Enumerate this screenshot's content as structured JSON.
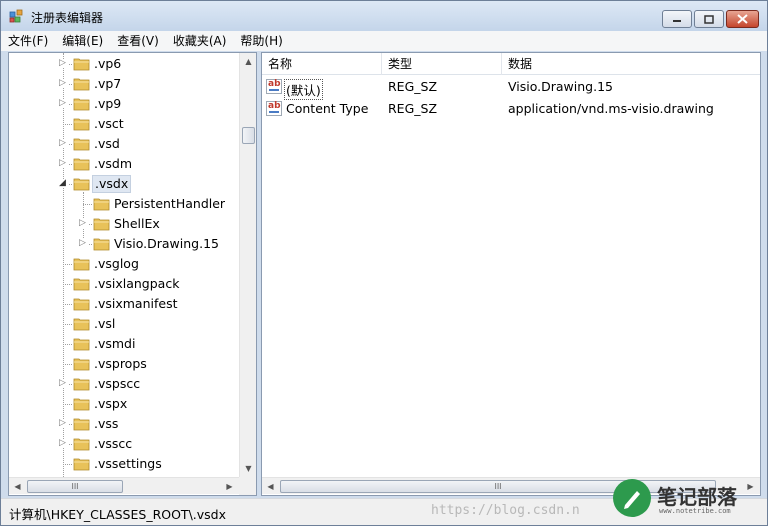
{
  "window": {
    "title": "注册表编辑器"
  },
  "menu": [
    "文件(F)",
    "编辑(E)",
    "查看(V)",
    "收藏夹(A)",
    "帮助(H)"
  ],
  "tree": {
    "items": [
      {
        "label": ".vp6",
        "depth": 0,
        "expander": "▷"
      },
      {
        "label": ".vp7",
        "depth": 0,
        "expander": "▷"
      },
      {
        "label": ".vp9",
        "depth": 0,
        "expander": "▷"
      },
      {
        "label": ".vsct",
        "depth": 0,
        "expander": ""
      },
      {
        "label": ".vsd",
        "depth": 0,
        "expander": "▷"
      },
      {
        "label": ".vsdm",
        "depth": 0,
        "expander": "▷"
      },
      {
        "label": ".vsdx",
        "depth": 0,
        "expander": "◢",
        "selected": true
      },
      {
        "label": "PersistentHandler",
        "depth": 1,
        "expander": ""
      },
      {
        "label": "ShellEx",
        "depth": 1,
        "expander": "▷"
      },
      {
        "label": "Visio.Drawing.15",
        "depth": 1,
        "expander": "▷"
      },
      {
        "label": ".vsglog",
        "depth": 0,
        "expander": ""
      },
      {
        "label": ".vsixlangpack",
        "depth": 0,
        "expander": ""
      },
      {
        "label": ".vsixmanifest",
        "depth": 0,
        "expander": ""
      },
      {
        "label": ".vsl",
        "depth": 0,
        "expander": ""
      },
      {
        "label": ".vsmdi",
        "depth": 0,
        "expander": ""
      },
      {
        "label": ".vsprops",
        "depth": 0,
        "expander": ""
      },
      {
        "label": ".vspscc",
        "depth": 0,
        "expander": "▷"
      },
      {
        "label": ".vspx",
        "depth": 0,
        "expander": ""
      },
      {
        "label": ".vss",
        "depth": 0,
        "expander": "▷"
      },
      {
        "label": ".vsscc",
        "depth": 0,
        "expander": "▷"
      },
      {
        "label": ".vssettings",
        "depth": 0,
        "expander": ""
      }
    ]
  },
  "list": {
    "columns": [
      "名称",
      "类型",
      "数据"
    ],
    "rows": [
      {
        "name": "(默认)",
        "type": "REG_SZ",
        "data": "Visio.Drawing.15",
        "focused": true
      },
      {
        "name": "Content Type",
        "type": "REG_SZ",
        "data": "application/vnd.ms-visio.drawing"
      }
    ]
  },
  "hscroll_thumb_text": "III",
  "status": {
    "path": "计算机\\HKEY_CLASSES_ROOT\\.vsdx",
    "watermark": "https://blog.csdn.n",
    "logo_text": "笔记部落",
    "logo_sub": "www.notetribe.com"
  },
  "colors": {
    "folder": "#e8c25a",
    "selection": "#dfe7f2",
    "titlebar": "#cfdcec"
  }
}
